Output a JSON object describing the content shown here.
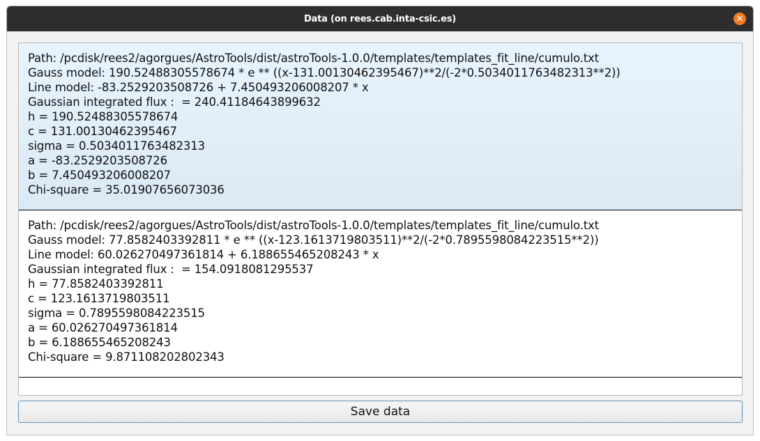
{
  "window": {
    "title": "Data (on rees.cab.inta-csic.es)",
    "close_icon": "close-icon"
  },
  "results": [
    {
      "selected": true,
      "lines": [
        "Path: /pcdisk/rees2/agorgues/AstroTools/dist/astroTools-1.0.0/templates/templates_fit_line/cumulo.txt",
        "Gauss model: 190.52488305578674 * e ** ((x-131.00130462395467)**2/(-2*0.5034011763482313**2))",
        "Line model: -83.2529203508726 + 7.450493206008207 * x",
        "Gaussian integrated flux :  = 240.41184643899632",
        "h = 190.52488305578674",
        "c = 131.00130462395467",
        "sigma = 0.5034011763482313",
        "a = -83.2529203508726",
        "b = 7.450493206008207",
        "Chi-square = 35.01907656073036"
      ]
    },
    {
      "selected": false,
      "lines": [
        "Path: /pcdisk/rees2/agorgues/AstroTools/dist/astroTools-1.0.0/templates/templates_fit_line/cumulo.txt",
        "Gauss model: 77.8582403392811 * e ** ((x-123.1613719803511)**2/(-2*0.7895598084223515**2))",
        "Line model: 60.026270497361814 + 6.188655465208243 * x",
        "Gaussian integrated flux :  = 154.0918081295537",
        "h = 77.8582403392811",
        "c = 123.1613719803511",
        "sigma = 0.7895598084223515",
        "a = 60.026270497361814",
        "b = 6.188655465208243",
        "Chi-square = 9.871108202802343"
      ]
    }
  ],
  "footer": {
    "save_label": "Save data"
  }
}
